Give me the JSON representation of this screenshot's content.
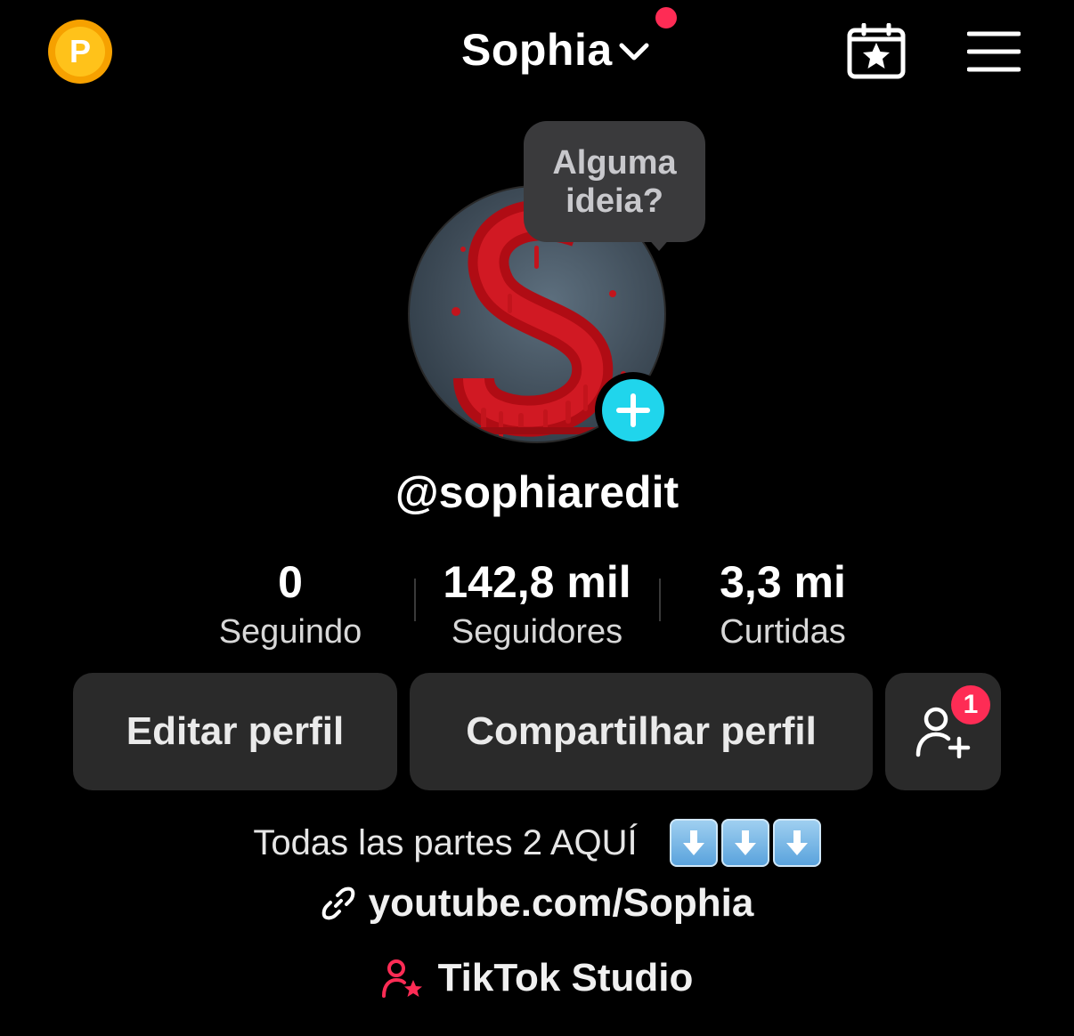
{
  "header": {
    "coin_letter": "P",
    "account_name": "Sophia"
  },
  "tooltip": {
    "line1": "Alguma",
    "line2": "ideia?"
  },
  "profile": {
    "username": "@sophiaredit"
  },
  "stats": [
    {
      "value": "0",
      "label": "Seguindo"
    },
    {
      "value": "142,8 mil",
      "label": "Seguidores"
    },
    {
      "value": "3,3 mi",
      "label": "Curtidas"
    }
  ],
  "buttons": {
    "edit": "Editar perfil",
    "share": "Compartilhar perfil",
    "friend_requests_count": "1"
  },
  "bio": {
    "text": "Todas las partes 2 AQUÍ"
  },
  "link": {
    "url": "youtube.com/Sophia"
  },
  "studio": {
    "label": "TikTok Studio"
  },
  "colors": {
    "background": "#000000",
    "accent_red": "#fe2c55",
    "accent_cyan": "#20d5ec",
    "coin_gold": "#ffc21a",
    "button_bg": "#2a2a2a"
  },
  "icons": [
    "coin-icon",
    "chevron-down-icon",
    "calendar-star-icon",
    "menu-icon",
    "plus-icon",
    "add-friend-icon",
    "arrow-down-emoji-icon",
    "link-icon",
    "creator-star-icon"
  ]
}
